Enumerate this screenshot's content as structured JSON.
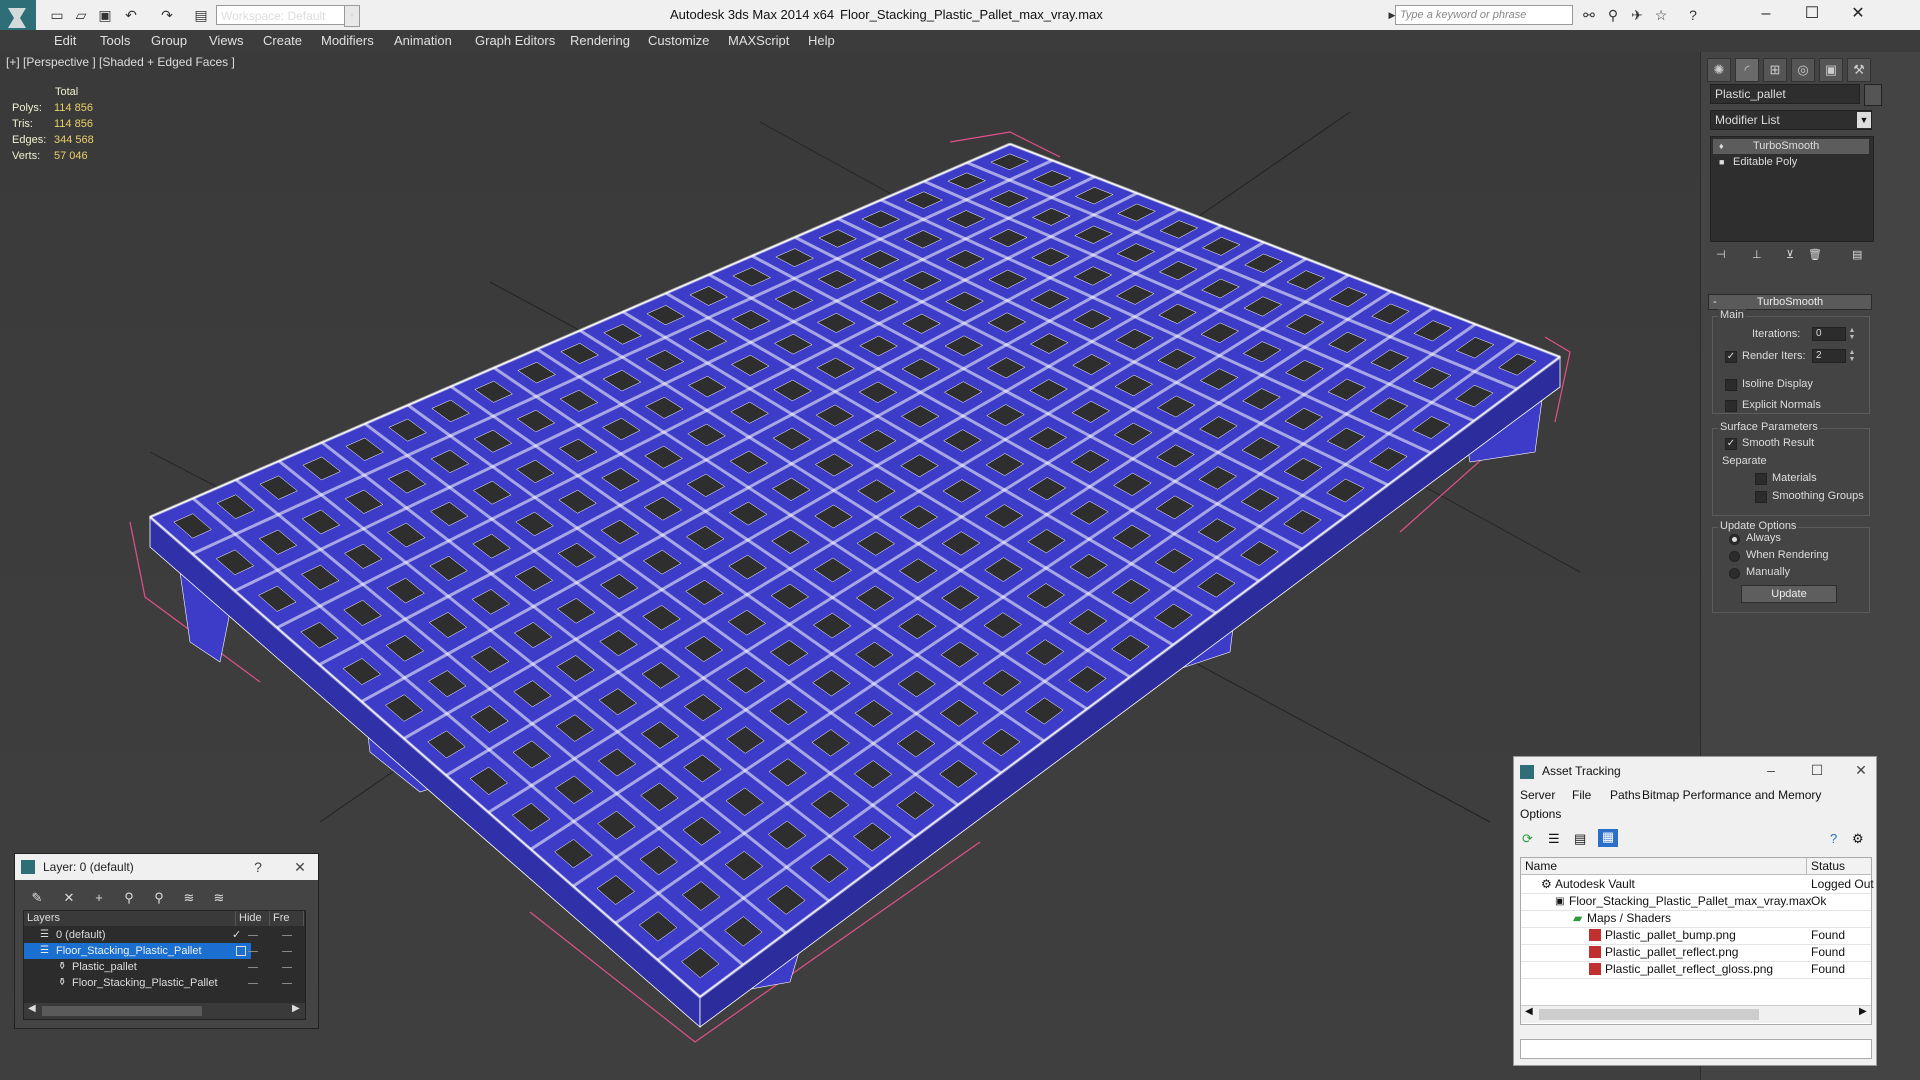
{
  "window": {
    "app_title": "Autodesk 3ds Max 2014 x64",
    "file_title": "Floor_Stacking_Plastic_Pallet_max_vray.max",
    "workspace": "Workspace: Default",
    "search_placeholder": "Type a keyword or phrase"
  },
  "menu": [
    "Edit",
    "Tools",
    "Group",
    "Views",
    "Create",
    "Modifiers",
    "Animation",
    "Graph Editors",
    "Rendering",
    "Customize",
    "MAXScript",
    "Help"
  ],
  "viewport": {
    "label": "[+] [Perspective ] [Shaded + Edged Faces ]",
    "stats_header": "Total",
    "stats": [
      {
        "label": "Polys:",
        "value": "114 856"
      },
      {
        "label": "Tris:",
        "value": "114 856"
      },
      {
        "label": "Edges:",
        "value": "344 568"
      },
      {
        "label": "Verts:",
        "value": "57 046"
      }
    ],
    "colors": {
      "mesh": "#3c3cc8",
      "wire": "#ffffff",
      "bbox": "#e0508c",
      "grid": "#222222"
    }
  },
  "command_panel": {
    "object_name": "Plastic_pallet",
    "modifier_list": "Modifier List",
    "stack": [
      "TurboSmooth",
      "Editable Poly"
    ],
    "rollout_title": "TurboSmooth",
    "main_group": "Main",
    "iterations_label": "Iterations:",
    "iterations_value": "0",
    "render_iters_label": "Render Iters:",
    "render_iters_value": "2",
    "isoline_label": "Isoline Display",
    "explicit_normals_label": "Explicit Normals",
    "surface_group": "Surface Parameters",
    "smooth_result_label": "Smooth Result",
    "separate_label": "Separate",
    "materials_label": "Materials",
    "smoothing_groups_label": "Smoothing Groups",
    "update_group": "Update Options",
    "always_label": "Always",
    "when_rendering_label": "When Rendering",
    "manually_label": "Manually",
    "update_button": "Update"
  },
  "layer_dialog": {
    "title": "Layer: 0 (default)",
    "help": "?",
    "columns": [
      "Layers",
      "Hide",
      "Fre"
    ],
    "rows": [
      "0 (default)",
      "Floor_Stacking_Plastic_Pallet",
      "Plastic_pallet",
      "Floor_Stacking_Plastic_Pallet"
    ]
  },
  "asset_tracking": {
    "title": "Asset Tracking",
    "menu": [
      "Server",
      "File",
      "Paths",
      "Bitmap Performance and Memory",
      "Options"
    ],
    "columns": [
      "Name",
      "Status"
    ],
    "rows": [
      {
        "name": "Autodesk Vault",
        "status": "Logged Out"
      },
      {
        "name": "Floor_Stacking_Plastic_Pallet_max_vray.max",
        "status": "Ok"
      },
      {
        "name": "Maps / Shaders",
        "status": ""
      },
      {
        "name": "Plastic_pallet_bump.png",
        "status": "Found"
      },
      {
        "name": "Plastic_pallet_reflect.png",
        "status": "Found"
      },
      {
        "name": "Plastic_pallet_reflect_gloss.png",
        "status": "Found"
      }
    ]
  }
}
